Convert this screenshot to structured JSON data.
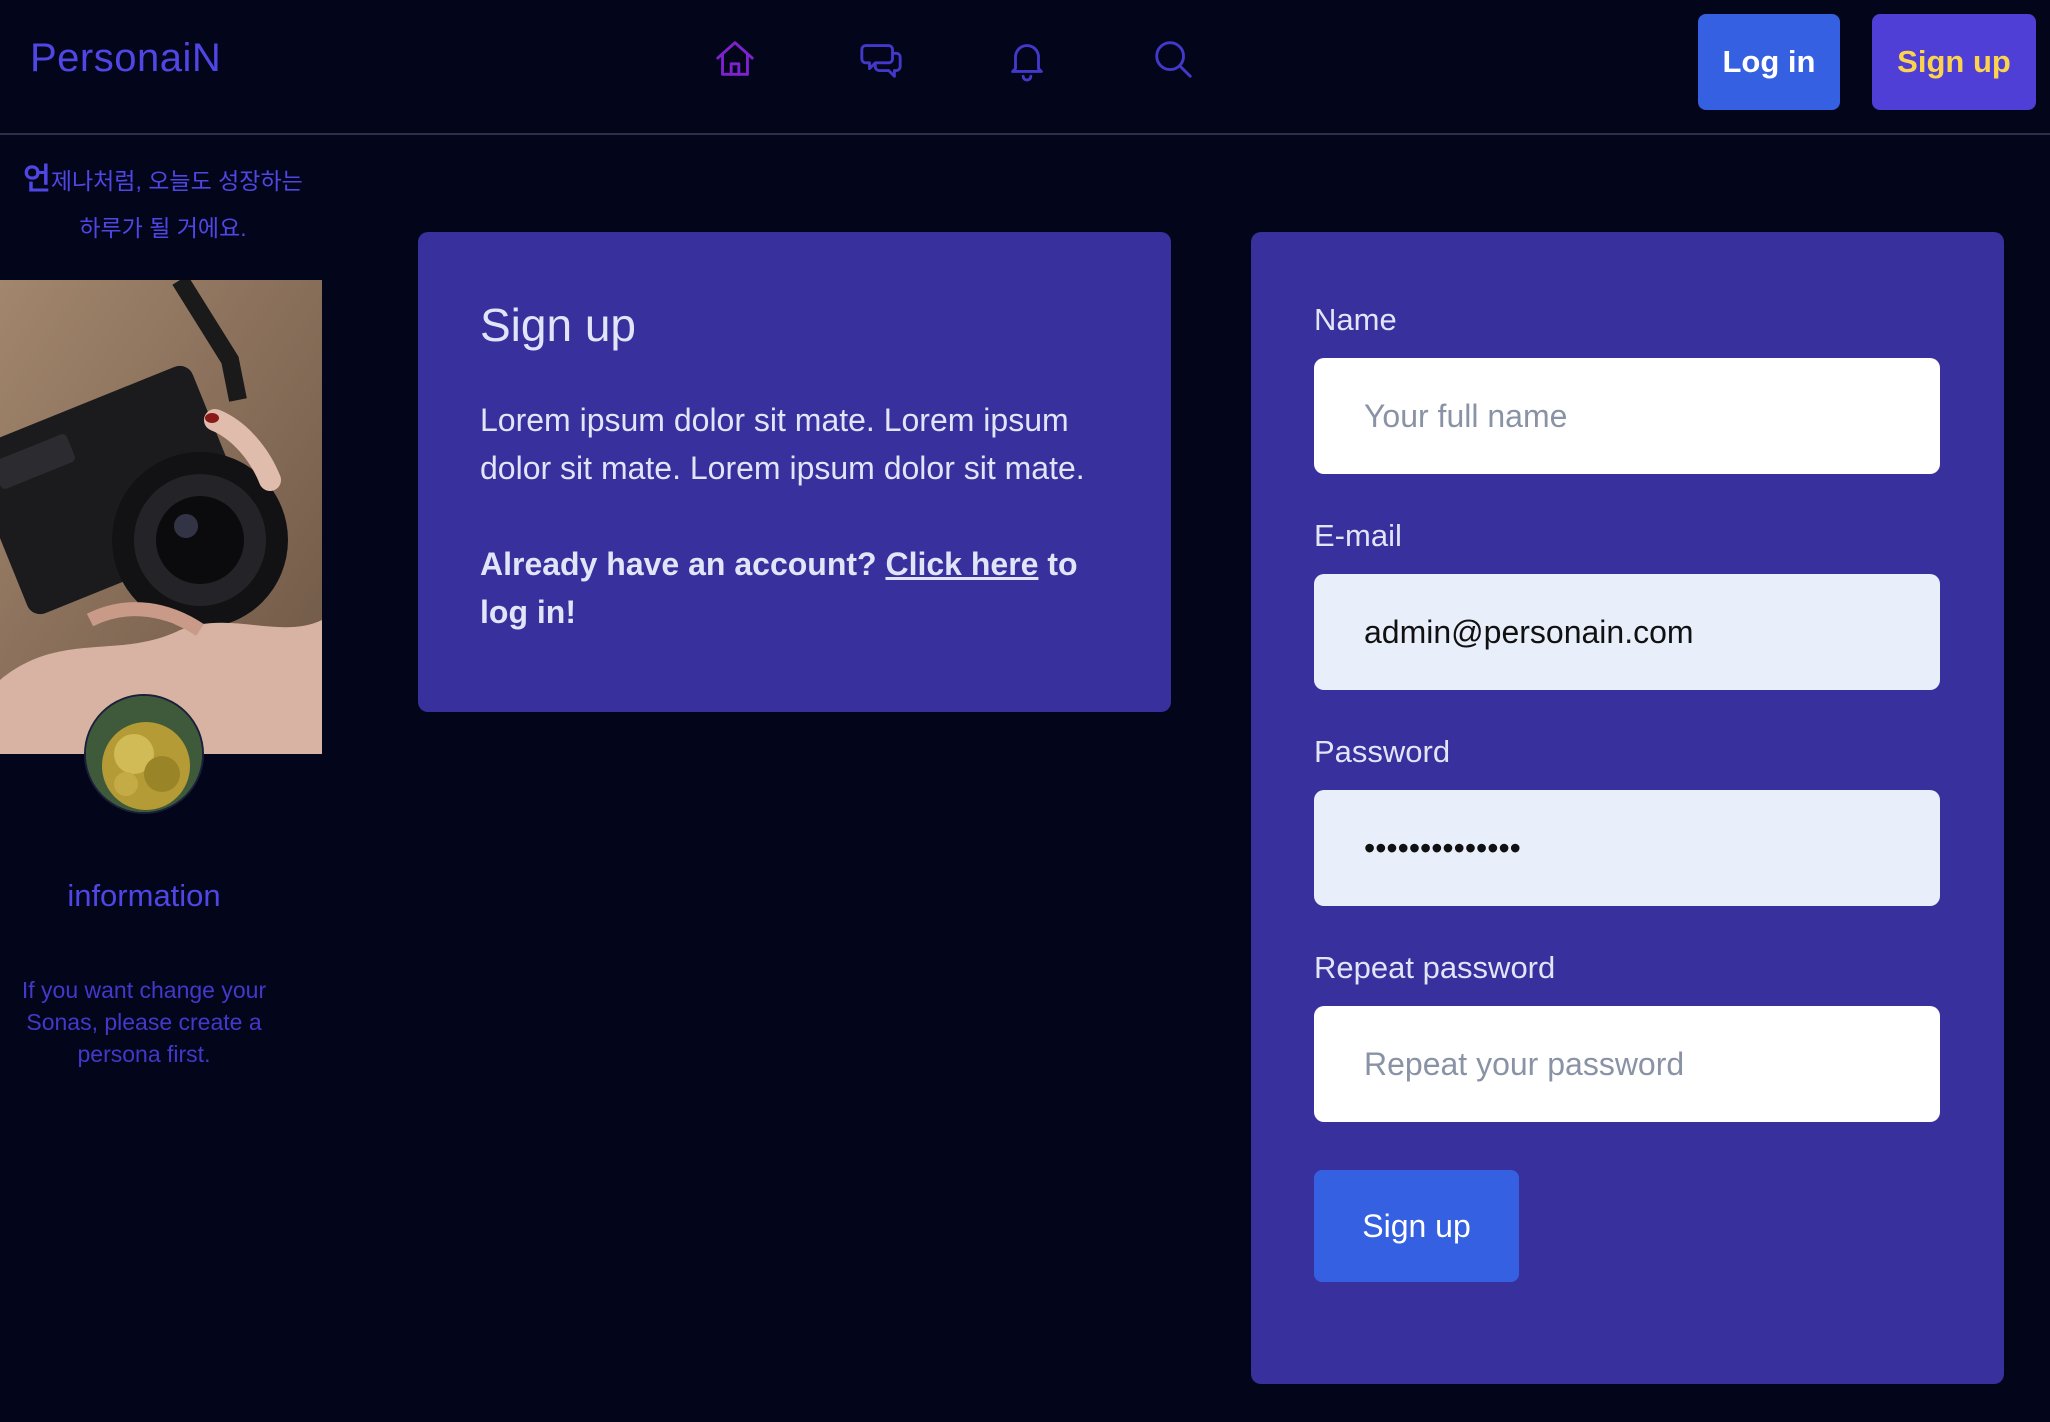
{
  "nav": {
    "brand": "PersonaiN",
    "icons": [
      "home-icon",
      "chat-icon",
      "bell-icon",
      "search-icon"
    ],
    "login_label": "Log in",
    "signup_label": "Sign up"
  },
  "sidebar": {
    "tagline_first_char": "언",
    "tagline_rest_line1": "제나처럼, 오늘도 성장하는",
    "tagline_line2": "하루가 될 거에요.",
    "info_title": "information",
    "info_text": "If you want change your Sonas, please create a persona first."
  },
  "info_card": {
    "title": "Sign up",
    "description": "Lorem ipsum dolor sit mate. Lorem ipsum dolor sit mate. Lorem ipsum dolor sit mate.",
    "already_prefix": "Already have an account?",
    "link_text": "Click here",
    "already_suffix": "to log in!"
  },
  "form": {
    "name_label": "Name",
    "name_placeholder": "Your full name",
    "name_value": "",
    "email_label": "E-mail",
    "email_value": "admin@personain.com",
    "password_label": "Password",
    "password_value": "••••••••••••••",
    "repeat_label": "Repeat password",
    "repeat_placeholder": "Repeat your password",
    "submit_label": "Sign up"
  },
  "colors": {
    "background": "#03061a",
    "brand": "#4f46e5",
    "card": "#37309d",
    "primary_button": "#3560e2",
    "signup_button": "#4f3fd6",
    "signup_text": "#fcd34d"
  }
}
